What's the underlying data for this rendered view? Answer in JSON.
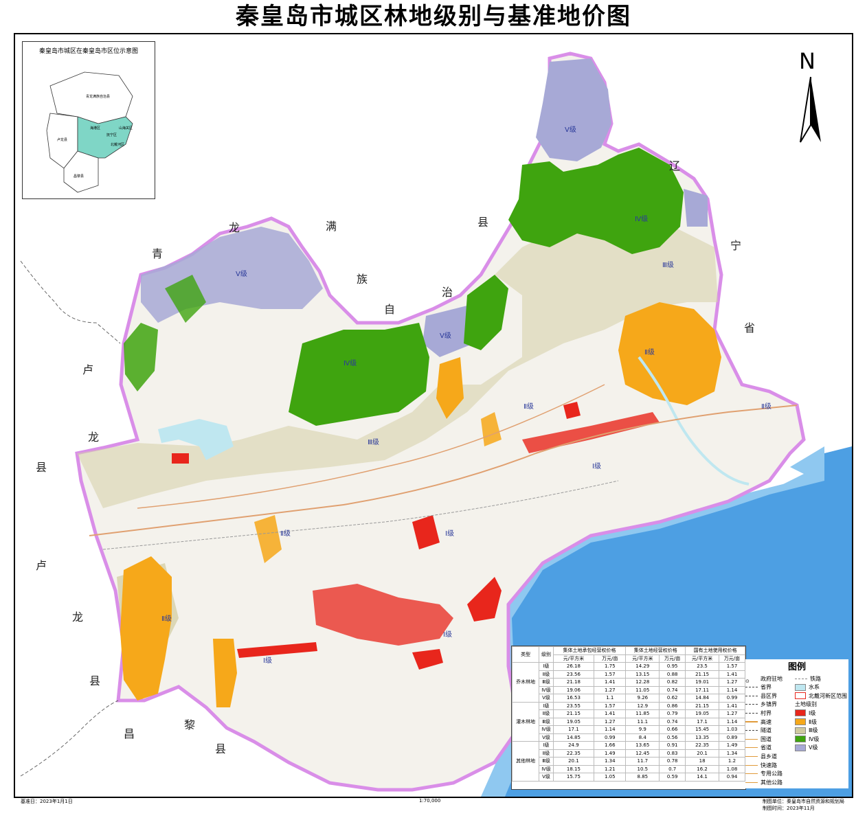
{
  "title": "秦皇岛市城区林地级别与基准地价图",
  "inset": {
    "title": "秦皇岛市城区在秦皇岛市区位示意图",
    "labels": [
      "青龙满族自治县",
      "卢龙县",
      "海港区",
      "抚宁区",
      "山海关区",
      "北戴河区",
      "昌黎县"
    ]
  },
  "north_label": "N",
  "place_labels": [
    "青",
    "龙",
    "满",
    "族",
    "自",
    "治",
    "县",
    "辽",
    "宁",
    "省",
    "卢",
    "龙",
    "县",
    "卢",
    "龙",
    "县",
    "昌",
    "黎",
    "县"
  ],
  "grade_labels": [
    "Ⅴ级",
    "Ⅴ级",
    "Ⅴ级",
    "Ⅳ级",
    "Ⅳ级",
    "Ⅲ级",
    "Ⅲ级",
    "Ⅱ级",
    "Ⅱ级",
    "Ⅱ级",
    "Ⅱ级",
    "Ⅱ级",
    "Ⅰ级",
    "Ⅰ级",
    "Ⅰ级",
    "Ⅰ级"
  ],
  "colors": {
    "grade1": "#e8261c",
    "grade2": "#f6a81a",
    "grade3": "#cfcaa0",
    "grade4": "#3fa40f",
    "grade5": "#a7a9d6",
    "water": "#bfe7f0",
    "sea": "#3b93de",
    "boundary": "#d98ee8"
  },
  "table": {
    "headers": [
      "类型",
      "级别",
      "集体土地承包经营权价格",
      "集体土地经营权价格",
      "国有土地使用权价格"
    ],
    "unit_row": [
      "元/平方米",
      "万元/亩",
      "元/平方米",
      "万元/亩",
      "元/平方米",
      "万元/亩"
    ],
    "groups": [
      {
        "type": "乔木林地",
        "rows": [
          [
            "Ⅰ级",
            "26.18",
            "1.75",
            "14.29",
            "0.95",
            "23.5",
            "1.57"
          ],
          [
            "Ⅱ级",
            "23.56",
            "1.57",
            "13.15",
            "0.88",
            "21.15",
            "1.41"
          ],
          [
            "Ⅲ级",
            "21.18",
            "1.41",
            "12.28",
            "0.82",
            "19.01",
            "1.27"
          ],
          [
            "Ⅳ级",
            "19.06",
            "1.27",
            "11.05",
            "0.74",
            "17.11",
            "1.14"
          ],
          [
            "Ⅴ级",
            "16.53",
            "1.1",
            "9.26",
            "0.62",
            "14.84",
            "0.99"
          ]
        ]
      },
      {
        "type": "灌木林地",
        "rows": [
          [
            "Ⅰ级",
            "23.55",
            "1.57",
            "12.9",
            "0.86",
            "21.15",
            "1.41"
          ],
          [
            "Ⅱ级",
            "21.15",
            "1.41",
            "11.85",
            "0.79",
            "19.05",
            "1.27"
          ],
          [
            "Ⅲ级",
            "19.05",
            "1.27",
            "11.1",
            "0.74",
            "17.1",
            "1.14"
          ],
          [
            "Ⅳ级",
            "17.1",
            "1.14",
            "9.9",
            "0.66",
            "15.45",
            "1.03"
          ],
          [
            "Ⅴ级",
            "14.85",
            "0.99",
            "8.4",
            "0.56",
            "13.35",
            "0.89"
          ]
        ]
      },
      {
        "type": "其他林地",
        "rows": [
          [
            "Ⅰ级",
            "24.9",
            "1.66",
            "13.65",
            "0.91",
            "22.35",
            "1.49"
          ],
          [
            "Ⅱ级",
            "22.35",
            "1.49",
            "12.45",
            "0.83",
            "20.1",
            "1.34"
          ],
          [
            "Ⅲ级",
            "20.1",
            "1.34",
            "11.7",
            "0.78",
            "18",
            "1.2"
          ],
          [
            "Ⅳ级",
            "18.15",
            "1.21",
            "10.5",
            "0.7",
            "16.2",
            "1.08"
          ],
          [
            "Ⅴ级",
            "15.75",
            "1.05",
            "8.85",
            "0.59",
            "14.1",
            "0.94"
          ]
        ]
      }
    ]
  },
  "legend": {
    "title": "图例",
    "left_items": [
      "政府驻地",
      "省界",
      "县区界",
      "乡镇界",
      "村界",
      "高速",
      "隧道",
      "国道",
      "省道",
      "县乡道",
      "快速路",
      "专用公路",
      "其他公路"
    ],
    "right_items": [
      "铁路",
      "水系",
      "北戴河新区范围"
    ],
    "grade_header": "土地级别",
    "grade_items": [
      "Ⅰ级",
      "Ⅱ级",
      "Ⅲ级",
      "Ⅳ级",
      "Ⅴ级"
    ]
  },
  "footer": {
    "base_date": "基准日：2023年1月1日",
    "scale": "1:70,000",
    "maker": "制图单位：秦皇岛市自然资源和规划局",
    "make_date": "制图时间：2023年11月"
  }
}
